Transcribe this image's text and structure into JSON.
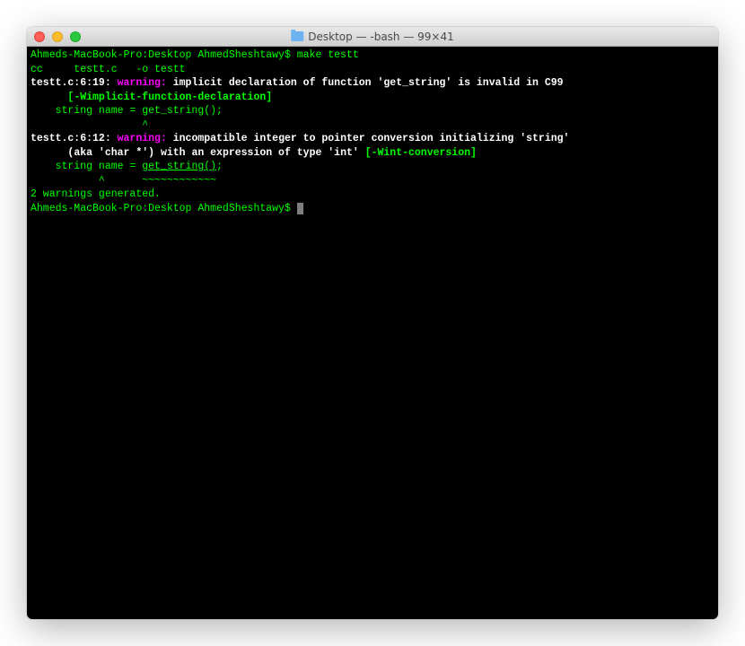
{
  "window": {
    "title": "Desktop — -bash — 99×41"
  },
  "terminal": {
    "prompt1": "Ahmeds-MacBook-Pro:Desktop AhmedSheshtawy$ ",
    "command1": "make testt",
    "cc_line": "cc     testt.c   -o testt",
    "warn1": {
      "loc": "testt.c:6:19: ",
      "label": "warning: ",
      "msg": "implicit declaration of function 'get_string' is invalid in C99",
      "flag_indent": "      ",
      "flag": "[-Wimplicit-function-declaration]",
      "code": "    string name = get_string();",
      "caret": "                  ^"
    },
    "warn2": {
      "loc": "testt.c:6:12: ",
      "label": "warning: ",
      "msg": "incompatible integer to pointer conversion initializing 'string'",
      "msg2_indent": "      ",
      "msg2": "(aka 'char *') with an expression of type 'int' ",
      "flag": "[-Wint-conversion]",
      "code_pre": "    string name = ",
      "code_underlined": "get_string()",
      "code_post": ";",
      "caret": "           ^      ~~~~~~~~~~~~"
    },
    "summary": "2 warnings generated.",
    "prompt2": "Ahmeds-MacBook-Pro:Desktop AhmedSheshtawy$ "
  }
}
